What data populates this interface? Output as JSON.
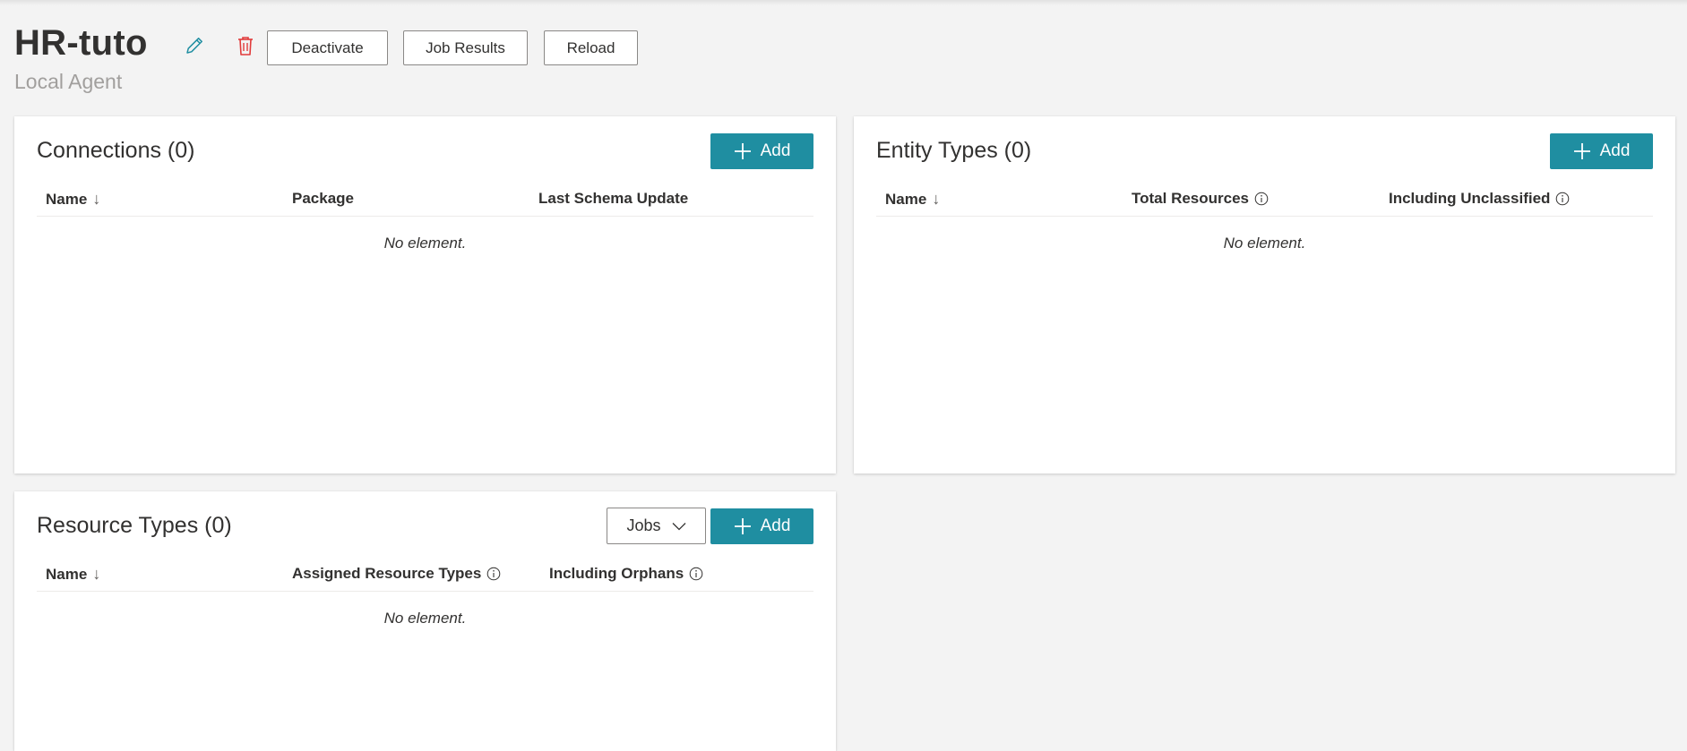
{
  "header": {
    "title": "HR-tuto",
    "subtitle": "Local Agent",
    "buttons": {
      "deactivate": "Deactivate",
      "job_results": "Job Results",
      "reload": "Reload"
    }
  },
  "connections": {
    "title": "Connections (0)",
    "add_label": "Add",
    "columns": [
      "Name",
      "Package",
      "Last Schema Update"
    ],
    "sort_indicator": "↓",
    "empty_text": "No element."
  },
  "entity_types": {
    "title": "Entity Types (0)",
    "add_label": "Add",
    "columns": [
      "Name",
      "Total Resources",
      "Including Unclassified"
    ],
    "sort_indicator": "↓",
    "empty_text": "No element."
  },
  "resource_types": {
    "title": "Resource Types (0)",
    "jobs_label": "Jobs",
    "add_label": "Add",
    "columns": [
      "Name",
      "Assigned Resource Types",
      "Including Orphans"
    ],
    "sort_indicator": "↓",
    "empty_text": "No element."
  },
  "colors": {
    "accent": "#1f8ea1",
    "delete": "#e13b3b",
    "edit": "#1f8ea1"
  },
  "icons": {
    "edit": "pencil-icon",
    "delete": "trash-icon",
    "add": "plus-icon",
    "info": "info-icon",
    "jobs": "chevron-down-icon"
  }
}
